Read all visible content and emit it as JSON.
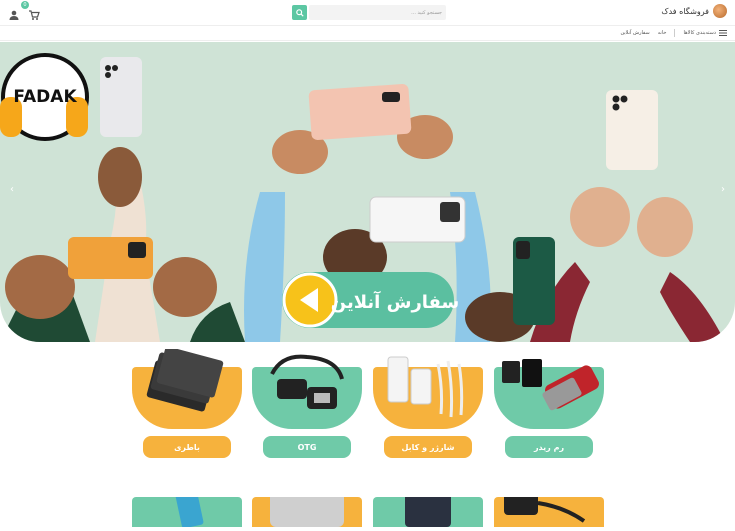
{
  "header": {
    "store_name": "فروشگاه فدک",
    "search_placeholder": "جستجو کنید ...",
    "cart_count": "0"
  },
  "nav": {
    "categories_label": "دسته‌بندی کالاها",
    "home_label": "خانه",
    "online_order_label": "سفارش آنلاین"
  },
  "banner": {
    "logo_text": "FADAK",
    "cta_text": "سفارش آنلاین",
    "colors": {
      "background": "#cfe3d6",
      "accent": "#5cc7a3"
    }
  },
  "categories": [
    {
      "label": "رم ریدر",
      "color": "#6fcaa8"
    },
    {
      "label": "شارژر و کابل",
      "color": "#f6b23d"
    },
    {
      "label": "OTG",
      "color": "#6fcaa8"
    },
    {
      "label": "باطری",
      "color": "#f6b23d"
    }
  ],
  "colors": {
    "green": "#6fcaa8",
    "orange": "#f6b23d",
    "search_button": "#5cc7a3"
  }
}
